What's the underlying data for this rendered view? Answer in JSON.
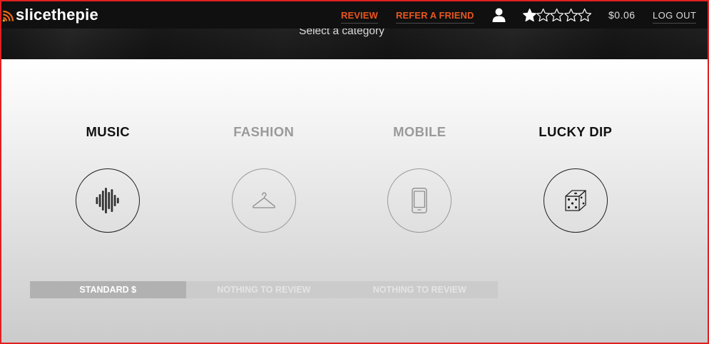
{
  "header": {
    "logo": {
      "text": "slicethepie",
      "icon": "signal-waves-icon"
    },
    "nav": {
      "review_label": "REVIEW",
      "refer_label": "REFER A FRIEND"
    },
    "profile_icon": "user-icon",
    "rating": {
      "value": 1,
      "max": 5,
      "icon": "star-icon"
    },
    "balance": "$0.06",
    "logout_label": "LOG OUT"
  },
  "banner": {
    "title": "Select a category"
  },
  "categories": [
    {
      "label": "MUSIC",
      "icon": "sound-wave-icon",
      "available": true,
      "status_label": "STANDARD $"
    },
    {
      "label": "FASHION",
      "icon": "hanger-icon",
      "available": false,
      "status_label": "NOTHING TO REVIEW"
    },
    {
      "label": "MOBILE",
      "icon": "mobile-phone-icon",
      "available": false,
      "status_label": "NOTHING TO REVIEW"
    },
    {
      "label": "LUCKY DIP",
      "icon": "dice-icon",
      "available": true
    }
  ],
  "colors": {
    "accent": "#e8561e",
    "header_background": "#101010",
    "available_text": "#111111",
    "unavailable_text": "#9a9a9a",
    "status_active_background": "#b1b1b1",
    "status_inactive_background": "#cbcbcb",
    "highlight_outline": "#e02020"
  }
}
